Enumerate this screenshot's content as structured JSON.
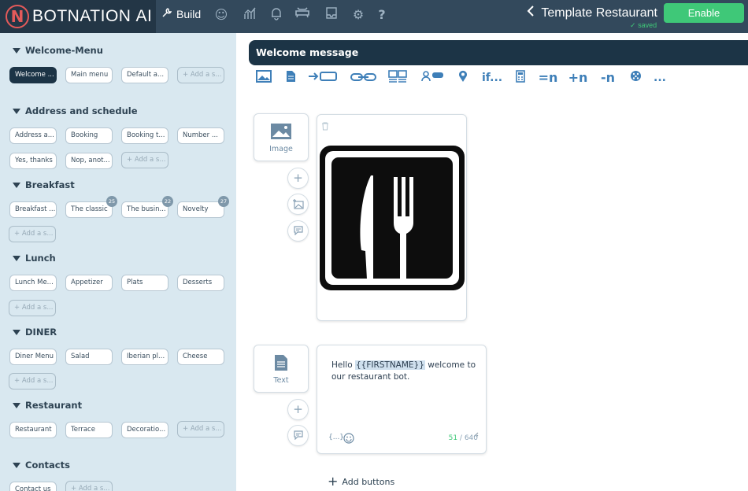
{
  "app": {
    "logo_text": "BOTNATION",
    "logo_suffix": "AI",
    "build_label": "Build",
    "page_title": "Template Restaurant",
    "enable_label": "Enable",
    "saved_label": "saved",
    "help_label": "?"
  },
  "sidebar": {
    "sections": [
      {
        "title": "Welcome-Menu",
        "items": [
          "Welcome ...",
          "Main menu",
          "Default a...",
          "+ Add a s..."
        ]
      },
      {
        "title": "Address and schedule",
        "items": [
          "Address a...",
          "Booking",
          "Booking t...",
          "Number ...",
          "Yes, thanks",
          "Nop, anot...",
          "+ Add a s..."
        ]
      },
      {
        "title": "Breakfast",
        "items": [
          "Breakfast ...",
          "The classic",
          "The busin...",
          "Novelty",
          "+ Add a s..."
        ],
        "badges": [
          "25",
          "22",
          "27"
        ]
      },
      {
        "title": "Lunch",
        "items": [
          "Lunch Me...",
          "Appetizer",
          "Plats",
          "Desserts",
          "+ Add a s..."
        ]
      },
      {
        "title": "DINER",
        "items": [
          "Diner Menu",
          "Salad",
          "Iberian pl...",
          "Cheese",
          "+ Add a s..."
        ]
      },
      {
        "title": "Restaurant",
        "items": [
          "Restaurant",
          "Terrace",
          "Decoratio...",
          "+ Add a s..."
        ]
      },
      {
        "title": "Contacts",
        "items": [
          "Contact us",
          "+ Add a s..."
        ]
      }
    ]
  },
  "main": {
    "header_title": "Welcome message",
    "toolbar": [
      "image-icon",
      "file-icon",
      "arrow-box-icon",
      "link-icon",
      "gallery-icon",
      "user-tag-icon",
      "location-icon",
      "if...",
      "calculator-icon",
      "=n",
      "+n",
      "-n",
      "dice-icon",
      "..."
    ],
    "image_block": {
      "label": "Image"
    },
    "text_block": {
      "label": "Text",
      "text_before": "Hello ",
      "variable": "{{FIRSTNAME}}",
      "text_after": " welcome to our restaurant bot.",
      "variables_hint": "{...}",
      "char_count": "51",
      "char_limit": "/ 640"
    },
    "add_buttons_label": "Add buttons"
  },
  "colors": {
    "topbar": "#33495c",
    "sidebar": "#d9e8f0",
    "header": "#1c3446",
    "accent_green": "#3fc878",
    "icon_blue": "#3e7fb8",
    "logo_red": "#e35a5a"
  }
}
